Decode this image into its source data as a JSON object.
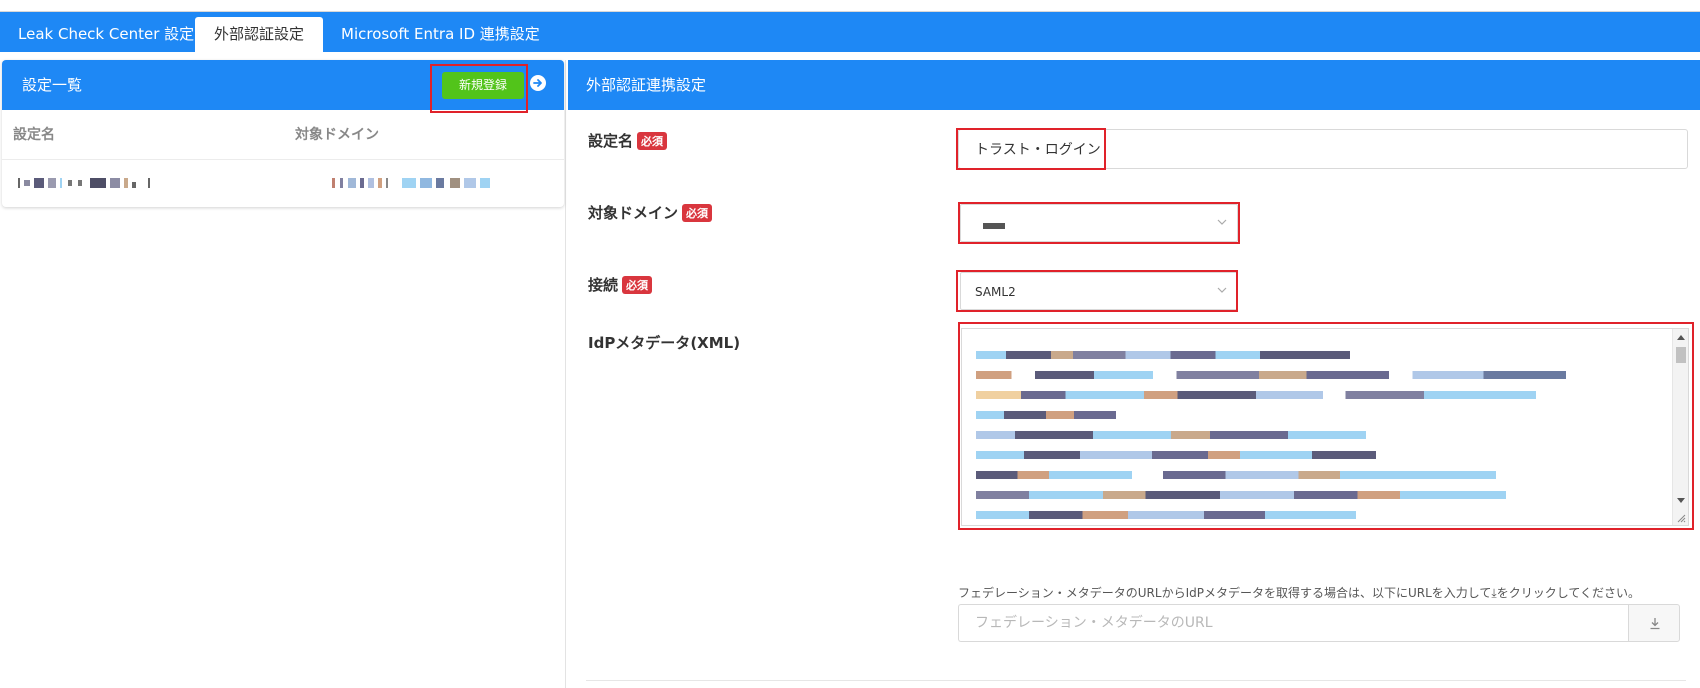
{
  "tabs": [
    {
      "label": "Leak Check Center 設定",
      "active": false
    },
    {
      "label": "外部認証設定",
      "active": true
    },
    {
      "label": "Microsoft Entra ID 連携設定",
      "active": false
    }
  ],
  "left_panel": {
    "title": "設定一覧",
    "new_button": "新規登録",
    "arrow_icon": "arrow-right-circle-icon",
    "columns": [
      "設定名",
      "対象ドメイン"
    ]
  },
  "right_panel": {
    "title": "外部認証連携設定",
    "required_badge": "必須",
    "fields": {
      "name_label": "設定名",
      "name_value": "トラスト・ログイン",
      "domain_label": "対象ドメイン",
      "connection_label": "接続",
      "connection_value": "SAML2",
      "metadata_label": "IdPメタデータ(XML)"
    },
    "hint": "フェデレーション・メタデータのURLからIdPメタデータを取得する場合は、以下にURLを入力して⤓をクリックしてください。",
    "url_placeholder": "フェデレーション・メタデータのURL",
    "download_icon": "download-icon"
  },
  "colors": {
    "brand_blue": "#1e88f5",
    "new_button_green": "#52c41a",
    "required_red": "#d9363e",
    "highlight_red": "#e0222a"
  }
}
